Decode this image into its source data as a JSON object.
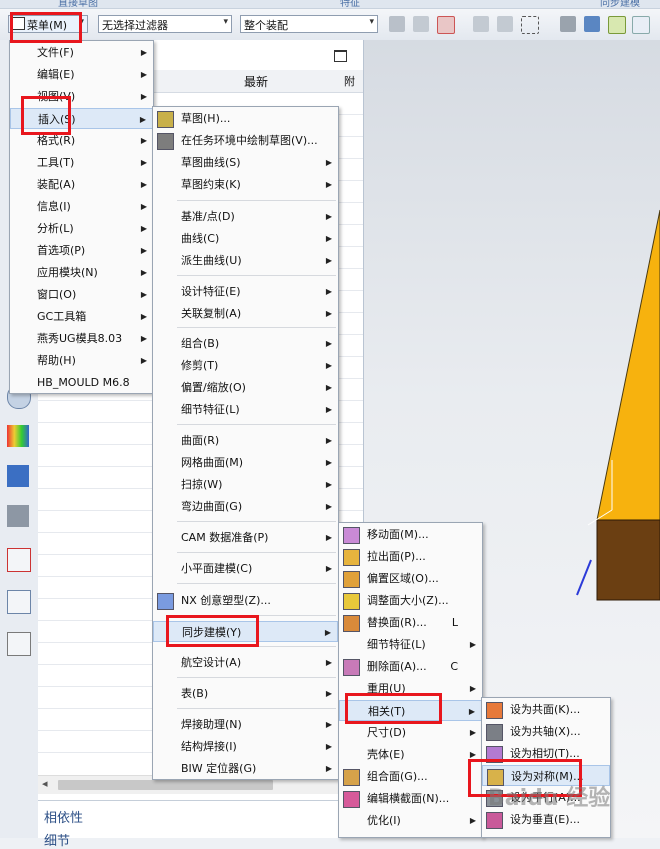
{
  "ribbon": {
    "left_text": "直接草图",
    "mid_text": "特征",
    "right_text": "同步建模"
  },
  "toolbar": {
    "menu_button": "菜单(M)",
    "filter_value": "无选择过滤器",
    "assembly_value": "整个装配"
  },
  "navigator": {
    "col_latest": "最新",
    "col_cut": "附",
    "dependency": "相依性",
    "details": "细节"
  },
  "main_menu": {
    "items": [
      {
        "label": "文件(F)"
      },
      {
        "label": "编辑(E)"
      },
      {
        "label": "视图(V)"
      },
      {
        "label": "插入(S)"
      },
      {
        "label": "格式(R)"
      },
      {
        "label": "工具(T)"
      },
      {
        "label": "装配(A)"
      },
      {
        "label": "信息(I)"
      },
      {
        "label": "分析(L)"
      },
      {
        "label": "首选项(P)"
      },
      {
        "label": "应用模块(N)"
      },
      {
        "label": "窗口(O)"
      },
      {
        "label": "GC工具箱"
      },
      {
        "label": "燕秀UG模具8.03"
      },
      {
        "label": "帮助(H)"
      },
      {
        "label": "HB_MOULD M6.8"
      }
    ]
  },
  "insert_menu": {
    "items": [
      {
        "label": "草图(H)..."
      },
      {
        "label": "在任务环境中绘制草图(V)..."
      },
      {
        "label": "草图曲线(S)"
      },
      {
        "label": "草图约束(K)"
      },
      {
        "label": "基准/点(D)"
      },
      {
        "label": "曲线(C)"
      },
      {
        "label": "派生曲线(U)"
      },
      {
        "label": "设计特征(E)"
      },
      {
        "label": "关联复制(A)"
      },
      {
        "label": "组合(B)"
      },
      {
        "label": "修剪(T)"
      },
      {
        "label": "偏置/缩放(O)"
      },
      {
        "label": "细节特征(L)"
      },
      {
        "label": "曲面(R)"
      },
      {
        "label": "网格曲面(M)"
      },
      {
        "label": "扫掠(W)"
      },
      {
        "label": "弯边曲面(G)"
      },
      {
        "label": "CAM 数据准备(P)"
      },
      {
        "label": "小平面建模(C)"
      },
      {
        "label": "NX 创意塑型(Z)..."
      },
      {
        "label": "同步建模(Y)"
      },
      {
        "label": "航空设计(A)"
      },
      {
        "label": "表(B)"
      },
      {
        "label": "焊接助理(N)"
      },
      {
        "label": "结构焊接(I)"
      },
      {
        "label": "BIW 定位器(G)"
      }
    ]
  },
  "sync_menu": {
    "items": [
      {
        "label": "移动面(M)..."
      },
      {
        "label": "拉出面(P)..."
      },
      {
        "label": "偏置区域(O)..."
      },
      {
        "label": "调整面大小(Z)..."
      },
      {
        "label": "替换面(R)...",
        "shortcut": "L"
      },
      {
        "label": "细节特征(L)"
      },
      {
        "label": "删除面(A)...",
        "shortcut": "C"
      },
      {
        "label": "重用(U)"
      },
      {
        "label": "相关(T)"
      },
      {
        "label": "尺寸(D)"
      },
      {
        "label": "壳体(E)"
      },
      {
        "label": "组合面(G)..."
      },
      {
        "label": "编辑横截面(N)..."
      },
      {
        "label": "优化(I)"
      }
    ]
  },
  "related_menu": {
    "items": [
      {
        "label": "设为共面(K)..."
      },
      {
        "label": "设为共轴(X)..."
      },
      {
        "label": "设为相切(T)..."
      },
      {
        "label": "设为对称(M)..."
      },
      {
        "label": "设为平行(A)..."
      },
      {
        "label": "设为垂直(E)..."
      }
    ]
  },
  "watermark": "Baidu 经验",
  "colors": {
    "highlight_box": "#e8161d",
    "part_orange": "#f7b20e",
    "part_brown": "#6b3f12"
  }
}
